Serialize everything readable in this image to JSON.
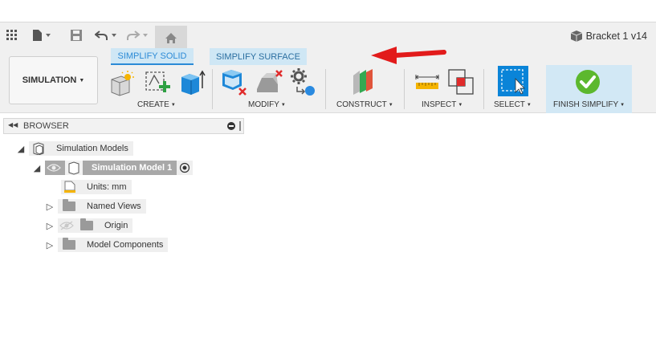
{
  "document": {
    "title": "Bracket 1 v14"
  },
  "quick_access": {
    "icons": [
      "grid-icon",
      "file-icon",
      "save-icon",
      "undo-icon",
      "redo-icon",
      "home-icon"
    ]
  },
  "ribbon": {
    "workspace_label": "SIMULATION",
    "tabs": [
      {
        "label": "SIMPLIFY SOLID",
        "active": true
      },
      {
        "label": "SIMPLIFY SURFACE",
        "active": false
      }
    ],
    "groups": {
      "create": "CREATE",
      "modify": "MODIFY",
      "construct": "CONSTRUCT",
      "inspect": "INSPECT",
      "select": "SELECT",
      "finish": "FINISH SIMPLIFY"
    }
  },
  "browser": {
    "title": "BROWSER",
    "root": "Simulation Models",
    "model": "Simulation Model 1",
    "units": "Units: mm",
    "children": [
      "Named Views",
      "Origin",
      "Model Components"
    ]
  },
  "colors": {
    "arrow": "#e21b1b",
    "accent": "#2b8ad6",
    "finish_check": "#5cb82e",
    "select_blue": "#0a84d8"
  }
}
